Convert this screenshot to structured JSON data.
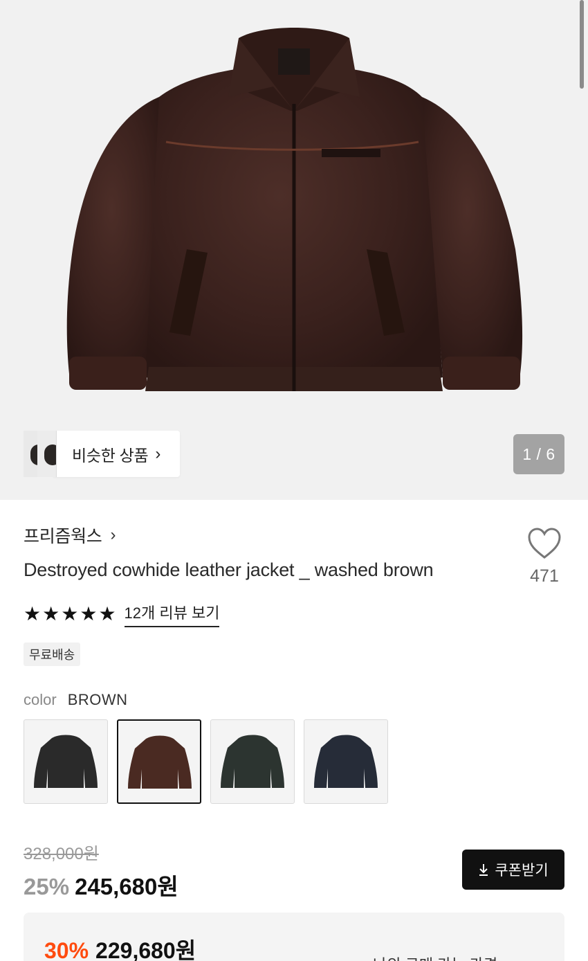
{
  "gallery": {
    "counter": "1 / 6",
    "similar_label": "비슷한 상품",
    "similar_chevron": "›"
  },
  "product": {
    "brand": "프리즘웍스",
    "brand_chevron": "›",
    "title": "Destroyed cowhide leather jacket _ washed brown",
    "likes": "471",
    "rating_stars": 5,
    "review_link": "12개 리뷰 보기",
    "badge": "무료배송"
  },
  "options": {
    "color_label": "color",
    "color_value": "BROWN",
    "swatches": [
      {
        "name": "black",
        "color": "#2a2a2a",
        "selected": false
      },
      {
        "name": "brown",
        "color": "#4a2a22",
        "selected": true
      },
      {
        "name": "green",
        "color": "#2c3430",
        "selected": false
      },
      {
        "name": "navy",
        "color": "#262c38",
        "selected": false
      }
    ]
  },
  "pricing": {
    "original": "328,000원",
    "discount": "25%",
    "sale": "245,680원",
    "coupon_button": "쿠폰받기",
    "best_discount": "30%",
    "best_price": "229,680원",
    "best_link": "나의 구매 가능 가격",
    "accent_color": "#ff4b0f"
  }
}
